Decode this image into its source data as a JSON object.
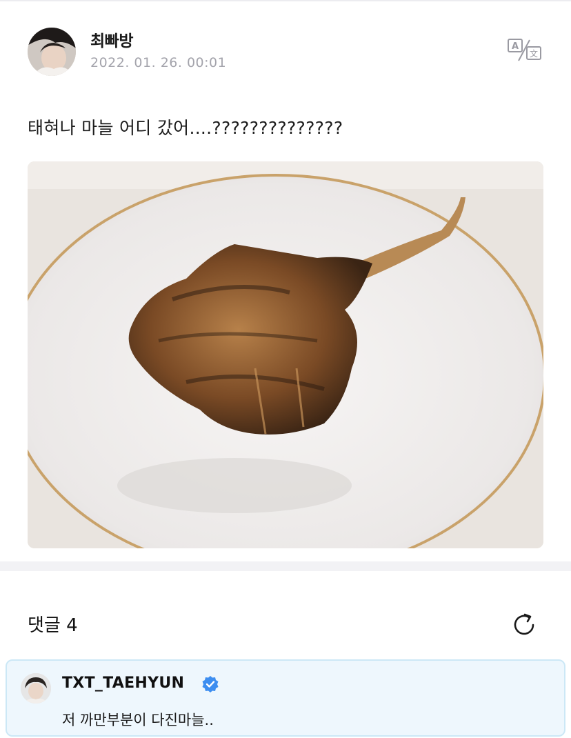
{
  "post": {
    "author": "최빠방",
    "date": "2022. 01. 26. 00:01",
    "text": "태혀나 마늘 어디 갔어....??????????????",
    "translate_icon": "translate-icon",
    "image_subject": "food-photo-icon"
  },
  "comments": {
    "title": "댓글 4",
    "refresh_icon": "refresh-icon",
    "items": [
      {
        "author": "TXT_TAEHYUN",
        "verified_icon": "verified-badge-icon",
        "text": "저 까만부분이 다진마늘.."
      }
    ]
  },
  "colors": {
    "comment_bg": "#eef7fd",
    "comment_border": "#cce8f6",
    "verified": "#3d8ef0",
    "date_gray": "#a4a4ac"
  }
}
